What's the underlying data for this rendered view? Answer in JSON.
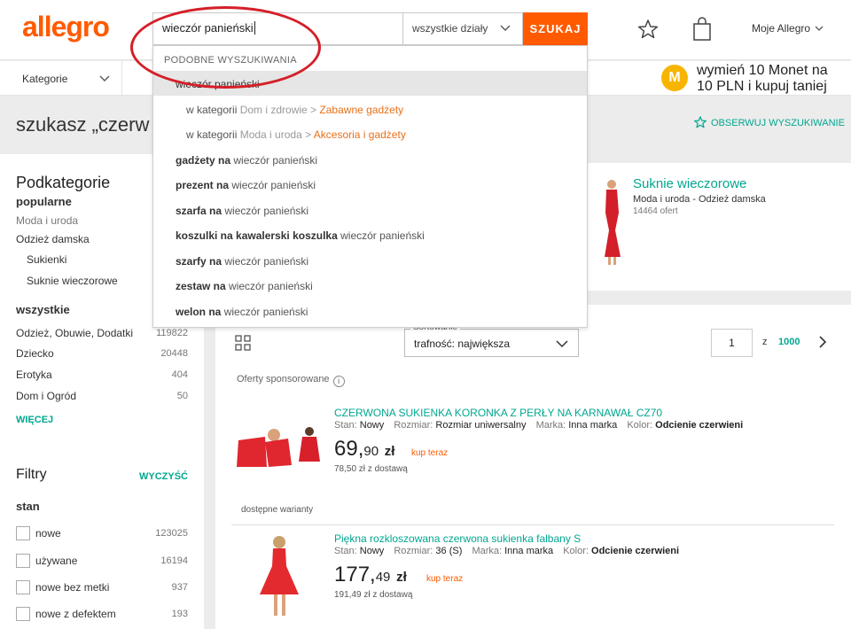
{
  "header": {
    "logo": "allegro",
    "search_value": "wieczór panieński",
    "department": "wszystkie działy",
    "search_button": "SZUKAJ",
    "my_allegro": "Moje Allegro"
  },
  "subbar": {
    "categories": "Kategorie",
    "promo_line1": "wymień 10 Monet na",
    "promo_line2": "10 PLN i kupuj taniej",
    "coin_letter": "M"
  },
  "titlebar": {
    "search_title": "szukasz „czerw",
    "watch": "OBSERWUJ WYSZUKIWANIE"
  },
  "dropdown": {
    "heading": "PODOBNE WYSZUKIWANIA",
    "top": "wieczór panieński",
    "in_category_prefix": "w kategorii",
    "cat1_path": "Dom i zdrowie >",
    "cat1_target": "Zabawne gadżety",
    "cat2_path": "Moda i uroda >",
    "cat2_target": "Akcesoria i gadżety",
    "suggestions": [
      {
        "bold": "gadżety na",
        "rest": "wieczór panieński"
      },
      {
        "bold": "prezent na",
        "rest": "wieczór panieński"
      },
      {
        "bold": "szarfa na",
        "rest": "wieczór panieński"
      },
      {
        "bold": "koszulki na kawalerski koszulka",
        "rest": "wieczór panieński"
      },
      {
        "bold": "szarfy na",
        "rest": "wieczór panieński"
      },
      {
        "bold": "zestaw na",
        "rest": "wieczór panieński"
      },
      {
        "bold": "welon na",
        "rest": "wieczór panieński"
      }
    ]
  },
  "sidebar": {
    "subcategories_title": "Podkategorie",
    "popular_label": "popularne",
    "popular_path": "Moda i uroda",
    "popular_cat": "Odzież damska",
    "popular_sub1": "Sukienki",
    "popular_sub2": "Suknie wieczorowe",
    "all_label": "wszystkie",
    "all_items": [
      {
        "label": "Odzież, Obuwie, Dodatki",
        "count": "119822"
      },
      {
        "label": "Dziecko",
        "count": "20448"
      },
      {
        "label": "Erotyka",
        "count": "404"
      },
      {
        "label": "Dom i Ogród",
        "count": "50"
      }
    ],
    "more": "WIĘCEJ",
    "filters_title": "Filtry",
    "clear": "WYCZYŚĆ",
    "condition_label": "stan",
    "conditions": [
      {
        "label": "nowe",
        "count": "123025"
      },
      {
        "label": "używane",
        "count": "16194"
      },
      {
        "label": "nowe bez metki",
        "count": "937"
      },
      {
        "label": "nowe z defektem",
        "count": "193"
      }
    ]
  },
  "featured": {
    "title": "Suknie wieczorowe",
    "path": "Moda i uroda - Odzież damska",
    "count": "14464 ofert"
  },
  "listing": {
    "sort_label": "Sortowanie",
    "sort_value": "trafność: największa",
    "page": "1",
    "page_of": "z",
    "page_total": "1000",
    "sponsored": "Oferty sponsorowane",
    "variants": "dostępne warianty",
    "buy_now": "kup teraz",
    "offers": [
      {
        "title": "CZERWONA SUKIENKA KORONKA Z PERŁY NA KARNAWAŁ CZ70",
        "stan_key": "Stan:",
        "stan_val": "Nowy",
        "size_key": "Rozmiar:",
        "size_val": "Rozmiar uniwersalny",
        "brand_key": "Marka:",
        "brand_val": "Inna marka",
        "color_key": "Kolor:",
        "color_val": "Odcienie czerwieni",
        "price_main": "69,",
        "price_cents": "90",
        "currency": "zł",
        "delivery": "78,50 zł z dostawą"
      },
      {
        "title": "Piękna rozkloszowana czerwona sukienka falbany S",
        "stan_key": "Stan:",
        "stan_val": "Nowy",
        "size_key": "Rozmiar:",
        "size_val": "36 (S)",
        "brand_key": "Marka:",
        "brand_val": "Inna marka",
        "color_key": "Kolor:",
        "color_val": "Odcienie czerwieni",
        "price_main": "177,",
        "price_cents": "49",
        "currency": "zł",
        "delivery": "191,49 zł z dostawą"
      }
    ]
  },
  "colors": {
    "brand": "#ff5a00",
    "accent": "#00a790",
    "annotation_ring": "#d51f28"
  }
}
